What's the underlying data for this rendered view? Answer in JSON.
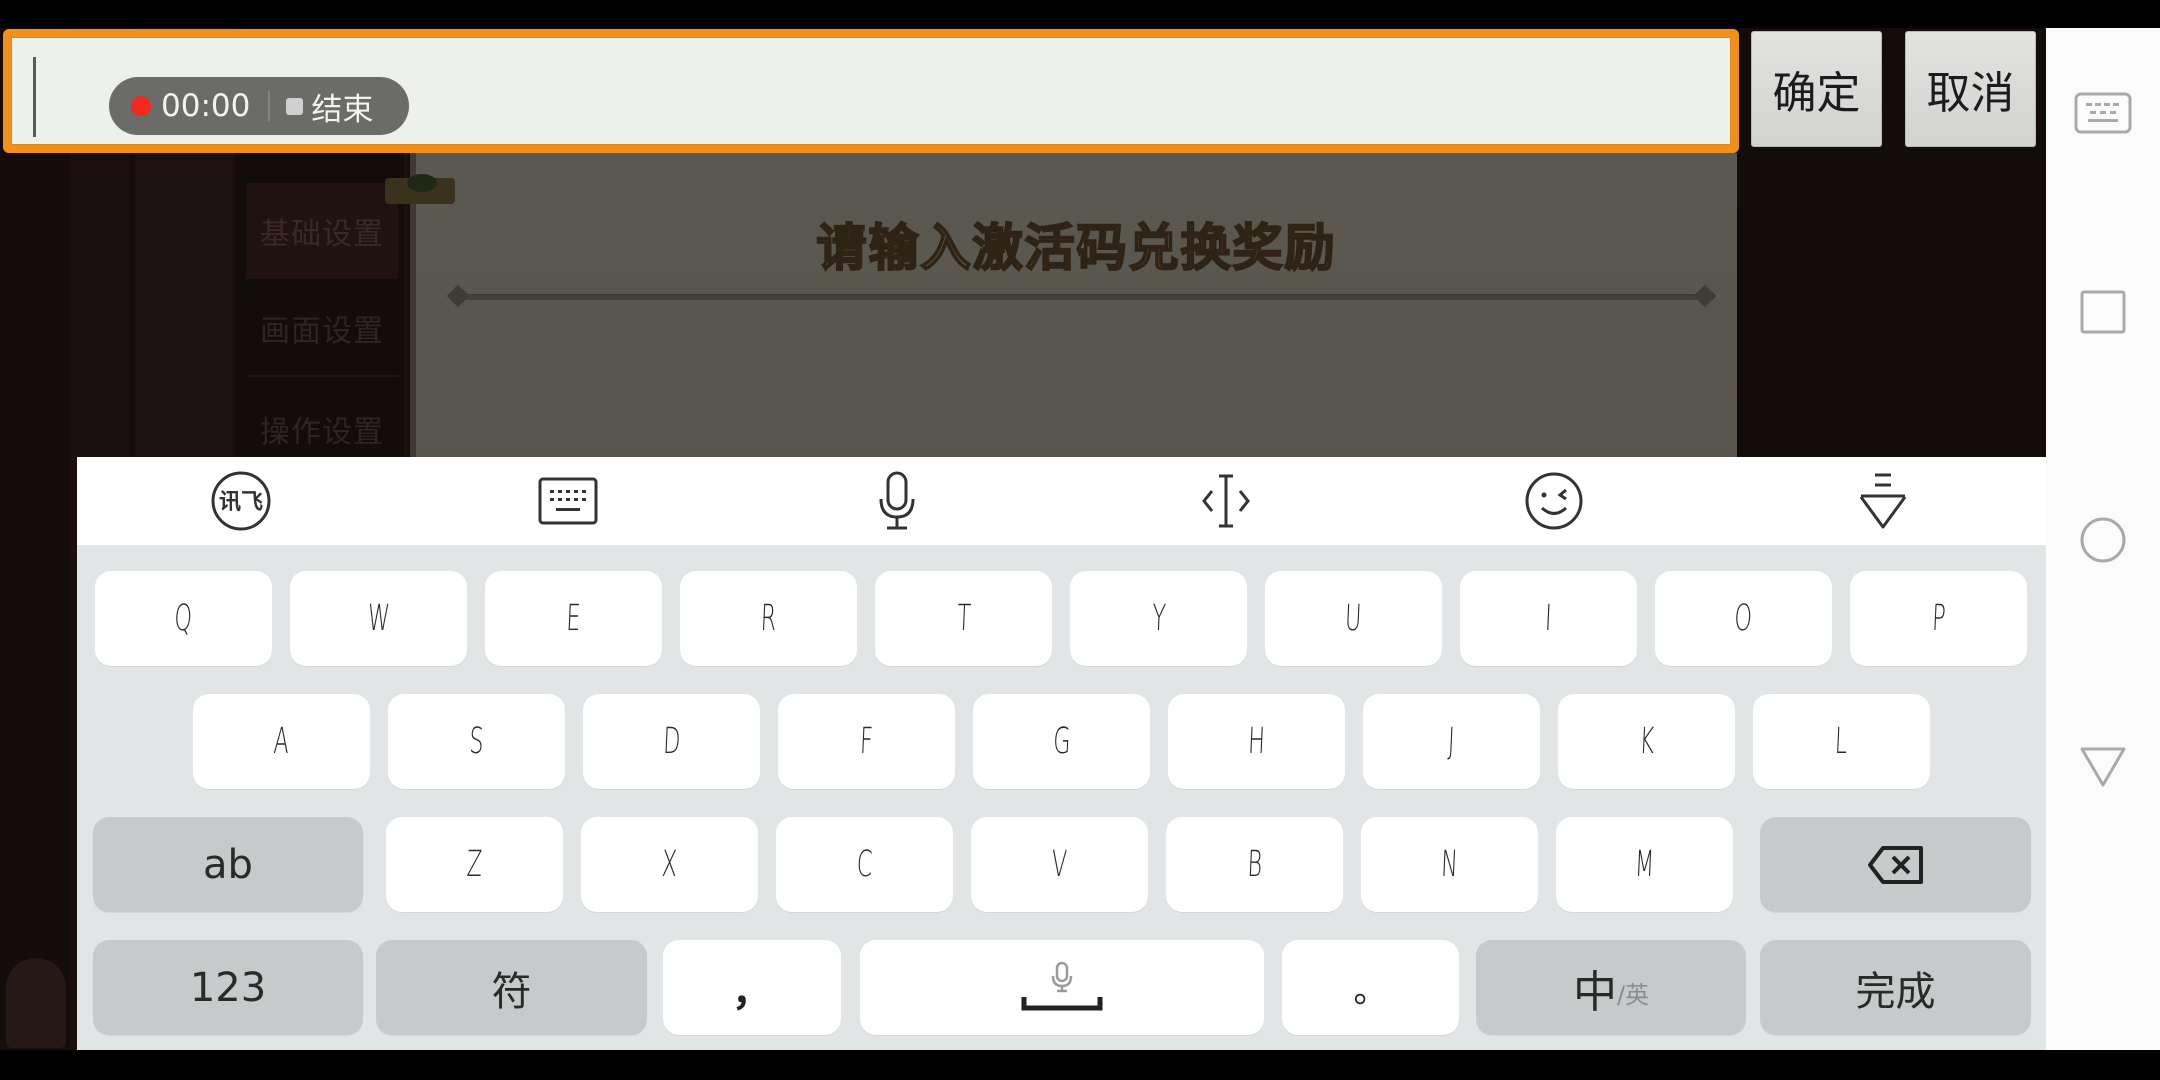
{
  "game": {
    "side_tabs": [
      {
        "label": "基础设置",
        "active": true
      },
      {
        "label": "画面设置",
        "active": false
      },
      {
        "label": "操作设置",
        "active": false
      }
    ],
    "panel_title": "请输入激活码兑换奖励"
  },
  "input_bar": {
    "value": "",
    "recording": {
      "time": "00:00",
      "stop_label": "结束",
      "dot_color": "#f02a1c"
    },
    "confirm_label": "确定",
    "cancel_label": "取消",
    "border_color": "#f0901c"
  },
  "navbar": {
    "icons": [
      "keyboard-switch-icon",
      "recents-icon",
      "home-icon",
      "back-icon"
    ]
  },
  "keyboard": {
    "toolbar": [
      "iflytek-logo-icon",
      "keyboard-layout-icon",
      "microphone-icon",
      "cursor-move-icon",
      "emoji-icon",
      "hide-keyboard-icon"
    ],
    "iflytek_logo_text": "讯飞",
    "row1": [
      "Q",
      "W",
      "E",
      "R",
      "T",
      "Y",
      "U",
      "I",
      "O",
      "P"
    ],
    "row2": [
      "A",
      "S",
      "D",
      "F",
      "G",
      "H",
      "J",
      "K",
      "L"
    ],
    "row3": [
      "Z",
      "X",
      "C",
      "V",
      "B",
      "N",
      "M"
    ],
    "shift_label": "ab",
    "numbers_label": "123",
    "symbols_label": "符",
    "comma_label": "，",
    "period_label": "。",
    "lang_main": "中",
    "lang_alt": "/英",
    "done_label": "完成"
  }
}
